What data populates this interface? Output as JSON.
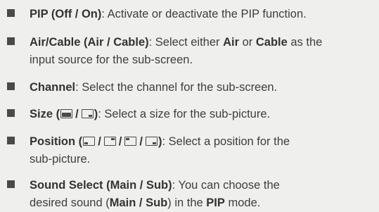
{
  "items": [
    {
      "label": "PIP (Off / On)",
      "desc": ": Activate or deactivate the PIP function."
    },
    {
      "label": "Air/Cable (Air / Cable)",
      "desc_a": ": Select either ",
      "b1": "Air",
      "desc_b": " or ",
      "b2": "Cable",
      "desc_c": " as the",
      "line2": "input source for the sub-screen."
    },
    {
      "label": "Channel",
      "desc": ": Select the channel for the sub-screen."
    },
    {
      "label": "Size",
      "open": " (",
      "slash": "/",
      "close": ")",
      "desc": ": Select a size for the sub-picture.",
      "icons": [
        "size-large-icon",
        "size-small-icon"
      ]
    },
    {
      "label": "Position",
      "open": " (",
      "slash": "/",
      "close": ")",
      "desc": ": Select a position for the",
      "line2": "sub-picture.",
      "icons": [
        "position-bottom-left-icon",
        "position-top-right-icon",
        "position-top-left-icon",
        "position-bottom-right-icon"
      ]
    },
    {
      "label": "Sound Select (Main / Sub)",
      "desc": ": You can choose the",
      "line2a": "desired sound (",
      "b1": "Main / Sub",
      "line2b": ") in the ",
      "b2": "PIP",
      "line2c": " mode."
    }
  ]
}
